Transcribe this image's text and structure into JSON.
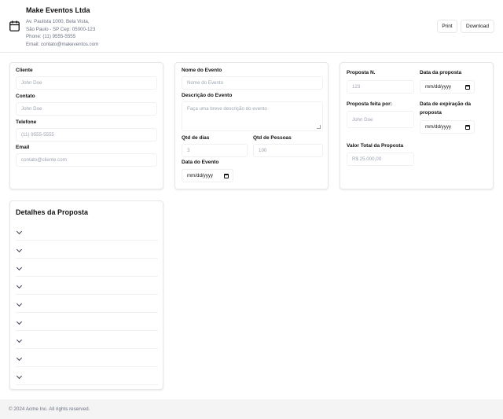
{
  "company": {
    "name": "Make Eventos Ltda",
    "address_line1": "Av. Paulista 1000, Bela Vista,",
    "address_line2": "São Paulo - SP Cep: 05000-123",
    "phone": "Phone: (11) 9555-5555",
    "email": "Email: contato@makeventos.com"
  },
  "actions": {
    "print": "Print",
    "download": "Download"
  },
  "client": {
    "cliente_label": "Cliente",
    "cliente_placeholder": "John Doe",
    "contato_label": "Contato",
    "contato_placeholder": "John Doe",
    "telefone_label": "Telefone",
    "telefone_placeholder": "(11) 9555-5555",
    "email_label": "Email",
    "email_placeholder": "contato@cliente.com"
  },
  "event": {
    "nome_label": "Nome do Evento",
    "nome_placeholder": "Nome do Evento",
    "descricao_label": "Descrição do Evento",
    "descricao_placeholder": "Faça uma breve descrição do evento",
    "dias_label": "Qtd de dias",
    "dias_placeholder": "3",
    "pessoas_label": "Qtd de Pessoas",
    "pessoas_placeholder": "100",
    "data_label": "Data do Evento",
    "data_value": "mm/dd/yyyy"
  },
  "proposal": {
    "numero_label": "Proposta N.",
    "numero_placeholder": "123",
    "data_label": "Data da proposta",
    "data_value": "mm/dd/yyyy",
    "feita_label": "Proposta feita por:",
    "feita_placeholder": "John Doe",
    "expiracao_label_1": "Data de expiração da",
    "expiracao_label_2": "proposta",
    "expiracao_value": "mm/dd/yyyy",
    "valor_label": "Valor Total da Proposta",
    "valor_placeholder": "R$ 25.000,00"
  },
  "details": {
    "title": "Detalhes da Proposta",
    "rows": 9
  },
  "footer": {
    "text": "© 2024 Acme Inc. All rights reserved."
  }
}
